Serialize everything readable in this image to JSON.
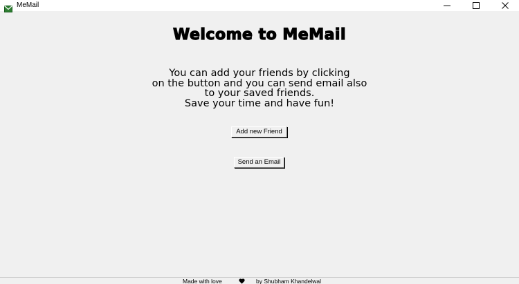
{
  "window": {
    "title": "MeMail",
    "icon": "mail-icon",
    "controls": [
      "minimize-icon",
      "maximize-icon",
      "close-icon"
    ]
  },
  "main": {
    "heading": "Welcome to MeMail",
    "intro_lines": [
      "You can add your friends by clicking",
      "on the button and you can send email also",
      "to your saved friends.",
      "Save your time and have fun!"
    ],
    "buttons": {
      "add_friend": "Add new Friend",
      "send_email": "Send an Email"
    }
  },
  "footer": {
    "made_with": "Made with love",
    "heart_icon": "heart-icon",
    "author": "by Shubham Khandelwal"
  },
  "colors": {
    "background": "#f0f0f0",
    "titlebar": "#ffffff",
    "text": "#000000"
  }
}
